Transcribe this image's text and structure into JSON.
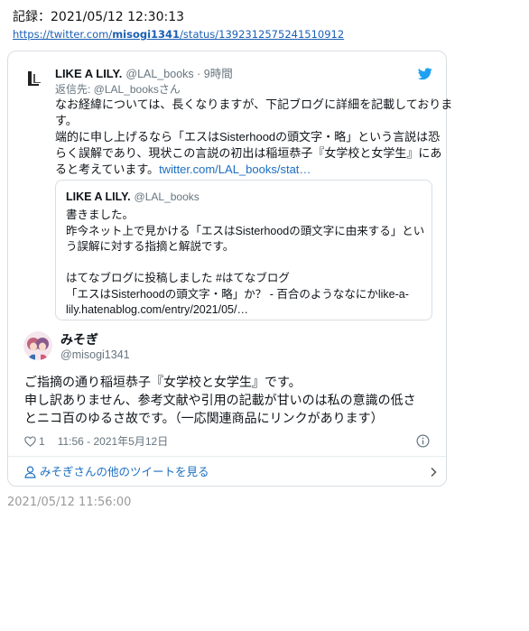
{
  "record": {
    "text": "記録：2021/05/12 12:30:13"
  },
  "source_url": {
    "prefix": "https://twitter.com/",
    "user": "misogi1341",
    "suffix": "/status/1392312575241510912"
  },
  "parent_tweet": {
    "name": "LIKE A LILY.",
    "handle": "@LAL_books · 9時間",
    "reply_to": "返信先: @LAL_booksさん",
    "lines": [
      "なお経緯については、長くなりますが、下記ブログに詳細を記載しておりま",
      "す。",
      "端的に申し上げるなら「エスはSisterhoodの頭文字・略」という言説は恐",
      "らく誤解であり、現状この言説の初出は稲垣恭子『女学校と女学生』にあ"
    ],
    "last_line": "ると考えています。",
    "link_text": "twitter.com/LAL_books/stat…"
  },
  "quoted_tweet": {
    "name": "LIKE A LILY.",
    "handle": "@LAL_books",
    "lines": [
      "書きました。",
      "昨今ネット上で見かける「エスはSisterhoodの頭文字に由来する」とい",
      "う誤解に対する指摘と解説です。",
      "",
      "はてなブログに投稿しました #はてなブログ",
      "「エスはSisterhoodの頭文字・略」か？ - 百合のようななにかlike-a-",
      "lily.hatenablog.com/entry/2021/05/…"
    ]
  },
  "main_tweet": {
    "name": "みそぎ",
    "handle": "@misogi1341",
    "lines": [
      "ご指摘の通り稲垣恭子『女学校と女学生』です。",
      "申し訳ありません、参考文献や引用の記載が甘いのは私の意識の低さ",
      "とニコ百のゆるさ故です。（一応関連商品にリンクがあります）"
    ],
    "likes": "1",
    "timestamp": "11:56 - 2021年5月12日"
  },
  "more_tweets": {
    "label": "みそぎさんの他のツイートを見る"
  },
  "footer": {
    "timestamp": "2021/05/12 11:56:00"
  },
  "colors": {
    "link": "#1b6ec2",
    "twitter_blue": "#1da1f2",
    "muted": "#66757f",
    "border": "#d9dee3"
  },
  "icons": [
    "twitter-bird-icon",
    "heart-icon",
    "info-icon",
    "person-icon",
    "chevron-right-icon",
    "lal-logo-icon"
  ]
}
